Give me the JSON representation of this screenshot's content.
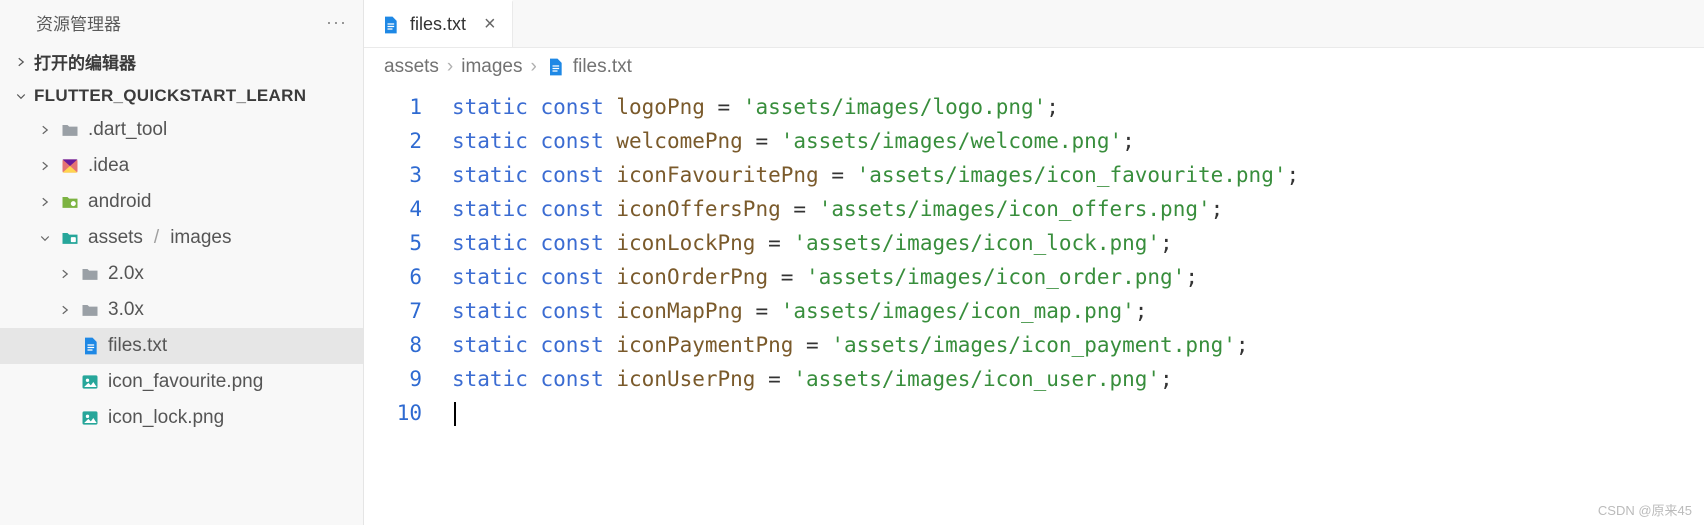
{
  "sidebar": {
    "title": "资源管理器",
    "open_editors": "打开的编辑器",
    "project": "FLUTTER_QUICKSTART_LEARN",
    "tree": [
      {
        "indent": 38,
        "chev": "right",
        "icon": "folder-gray",
        "label": ".dart_tool"
      },
      {
        "indent": 38,
        "chev": "right",
        "icon": "idea",
        "label": ".idea"
      },
      {
        "indent": 38,
        "chev": "right",
        "icon": "folder-green",
        "label": "android"
      },
      {
        "indent": 38,
        "chev": "down",
        "icon": "folder-teal",
        "label": "assets",
        "suffix": "images"
      },
      {
        "indent": 58,
        "chev": "right",
        "icon": "folder-gray",
        "label": "2.0x"
      },
      {
        "indent": 58,
        "chev": "right",
        "icon": "folder-gray",
        "label": "3.0x"
      },
      {
        "indent": 58,
        "chev": "blank",
        "icon": "file-blue",
        "label": "files.txt",
        "selected": true
      },
      {
        "indent": 58,
        "chev": "blank",
        "icon": "image-teal",
        "label": "icon_favourite.png"
      },
      {
        "indent": 58,
        "chev": "blank",
        "icon": "image-teal",
        "label": "icon_lock.png"
      }
    ]
  },
  "tab": {
    "filename": "files.txt"
  },
  "breadcrumbs": [
    "assets",
    "images",
    "files.txt"
  ],
  "code": {
    "lines": [
      {
        "kw": "static const",
        "var": "logoPng",
        "str": "'assets/images/logo.png'"
      },
      {
        "kw": "static const",
        "var": "welcomePng",
        "str": "'assets/images/welcome.png'"
      },
      {
        "kw": "static const",
        "var": "iconFavouritePng",
        "str": "'assets/images/icon_favourite.png'"
      },
      {
        "kw": "static const",
        "var": "iconOffersPng",
        "str": "'assets/images/icon_offers.png'"
      },
      {
        "kw": "static const",
        "var": "iconLockPng",
        "str": "'assets/images/icon_lock.png'"
      },
      {
        "kw": "static const",
        "var": "iconOrderPng",
        "str": "'assets/images/icon_order.png'"
      },
      {
        "kw": "static const",
        "var": "iconMapPng",
        "str": "'assets/images/icon_map.png'"
      },
      {
        "kw": "static const",
        "var": "iconPaymentPng",
        "str": "'assets/images/icon_payment.png'"
      },
      {
        "kw": "static const",
        "var": "iconUserPng",
        "str": "'assets/images/icon_user.png'"
      }
    ],
    "total_lines": 10
  },
  "watermark": "CSDN @原来45"
}
